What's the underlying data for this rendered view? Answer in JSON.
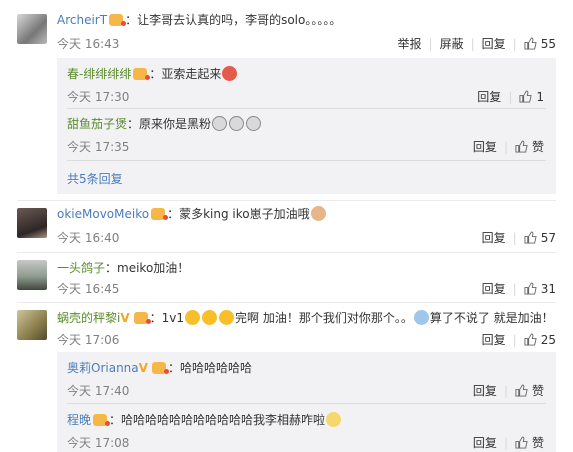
{
  "comments": [
    {
      "user": "ArcheirT",
      "text": "：让李哥去认真的吗，李哥的solo。。。。。",
      "time": "今天 16:43",
      "actions": {
        "report": "举报",
        "block": "屏蔽",
        "reply": "回复",
        "likes": "55"
      }
    },
    {
      "user": "okieMovoMeiko",
      "text": "：蒙多king iko崽子加油哦",
      "time": "今天 16:40",
      "actions": {
        "reply": "回复",
        "likes": "57"
      }
    },
    {
      "user": "一头鸽子",
      "text": "：meiko加油！",
      "time": "今天 16:45",
      "actions": {
        "reply": "回复",
        "likes": "31"
      }
    },
    {
      "user": "蜗壳的秤黎i",
      "text_a": "：1v1",
      "text_b": "完啊 加油！那个我们对你那个。。",
      "text_c": "算了不说了 就是加油！",
      "time": "今天 17:06",
      "actions": {
        "reply": "回复",
        "likes": "25"
      }
    }
  ],
  "replies_1": [
    {
      "user": "春-绯绯绯绯",
      "text": "：亚索走起来",
      "time": "今天 17:30",
      "reply": "回复",
      "likes": "1"
    },
    {
      "user": "甜鱼茄子煲",
      "text": "：原来你是黑粉",
      "time": "今天 17:35",
      "reply": "回复",
      "likes": "赞"
    }
  ],
  "replies_1_more": "共5条回复",
  "replies_4": [
    {
      "user": "奥莉Orianna",
      "text": "：哈哈哈哈哈哈",
      "time": "今天 17:40",
      "reply": "回复",
      "likes": "赞"
    },
    {
      "user": "程晚",
      "text": "：哈哈哈哈哈哈哈哈哈哈哈我李相赫咋啦",
      "time": "今天 17:08",
      "reply": "回复",
      "likes": "赞"
    }
  ]
}
